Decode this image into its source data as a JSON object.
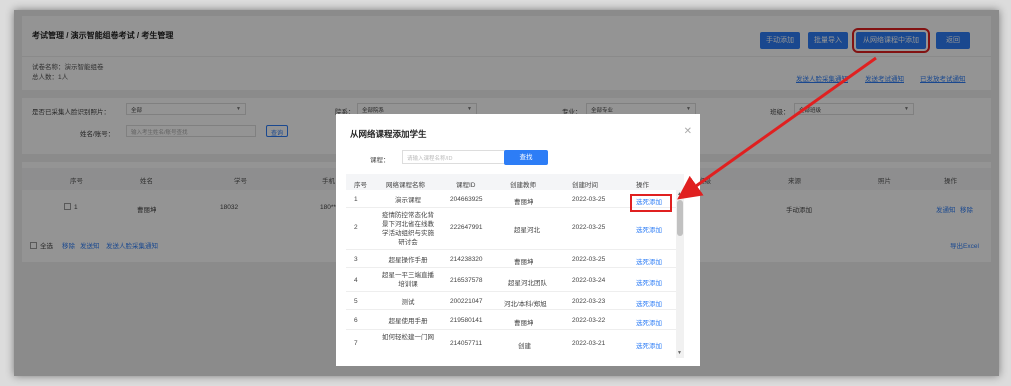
{
  "header": {
    "breadcrumb": "考试管理 / 演示智能组卷考试 / 考生管理",
    "buttons": {
      "manual_add": "手动添加",
      "batch_import": "批量导入",
      "add_from_course": "从网络课程中添加",
      "back": "返回"
    }
  },
  "info": {
    "paper_name": "试卷名称：演示智能组卷",
    "total": "总人数：1人",
    "links": {
      "send_face_notice": "发送人脸采集通知",
      "send_exam_notice": "发送考试通知",
      "sent_exam_notice": "已发放考试通知"
    }
  },
  "filters": {
    "face_label": "是否已采集人脸识别照片：",
    "face_value": "全部",
    "dept_label": "院系：",
    "dept_value": "全部院系",
    "major_label": "专业：",
    "major_value": "全部专业",
    "class_label": "班级：",
    "class_value": "全部班级",
    "name_label": "姓名/账号：",
    "name_placeholder": "输入考生姓名/账号查找",
    "query_button": "查询"
  },
  "table": {
    "headers": {
      "index": "序号",
      "name": "姓名",
      "student_id": "学号",
      "phone": "手机",
      "class": "班级",
      "source": "来源",
      "photo": "照片",
      "action": "操作"
    },
    "row": {
      "index": "1",
      "name": "曹丽坤",
      "student_id": "18032",
      "phone": "180**",
      "source": "手动添加",
      "action_notify": "发通知",
      "action_remove": "移除"
    },
    "footer": {
      "select_all": "全选",
      "remove": "移除",
      "notify": "发送知",
      "face_notice": "发送人脸采集通知",
      "export": "导出Excel"
    }
  },
  "modal": {
    "title": "从网络课程添加学生",
    "course_label": "课程：",
    "course_placeholder": "请输入课程名称/ID",
    "search_button": "查找",
    "headers": {
      "index": "序号",
      "course_name": "网络课程名称",
      "course_id": "课程ID",
      "creator": "创建教师",
      "created": "创建时间",
      "action": "操作"
    },
    "rows": [
      {
        "index": "1",
        "name": "演示课程",
        "id": "204663925",
        "creator": "曹丽坤",
        "date": "2022-03-25",
        "action": "选死添加"
      },
      {
        "index": "2",
        "name": "疫情防控常态化背景下河北省在线教学活动组织与实施研讨会",
        "id": "222647991",
        "creator": "超星河北",
        "date": "2022-03-25",
        "action": "选死添加"
      },
      {
        "index": "3",
        "name": "超星操作手册",
        "id": "214238320",
        "creator": "曹丽坤",
        "date": "2022-03-25",
        "action": "选死添加"
      },
      {
        "index": "4",
        "name": "超星一平三端直播培训课",
        "id": "216537578",
        "creator": "超星河北团队",
        "date": "2022-03-24",
        "action": "选死添加"
      },
      {
        "index": "5",
        "name": "测试",
        "id": "200221047",
        "creator": "河北/本科/郑旭",
        "date": "2022-03-23",
        "action": "选死添加"
      },
      {
        "index": "6",
        "name": "超星使用手册",
        "id": "219580141",
        "creator": "曹丽坤",
        "date": "2022-03-22",
        "action": "选死添加"
      },
      {
        "index": "7",
        "name": "如何轻松建一门网",
        "id": "214057711",
        "creator": "创建",
        "date": "2022-03-21",
        "action": "选死添加"
      }
    ]
  },
  "colors": {
    "accent": "#2d7df6",
    "highlight": "#e02020"
  }
}
